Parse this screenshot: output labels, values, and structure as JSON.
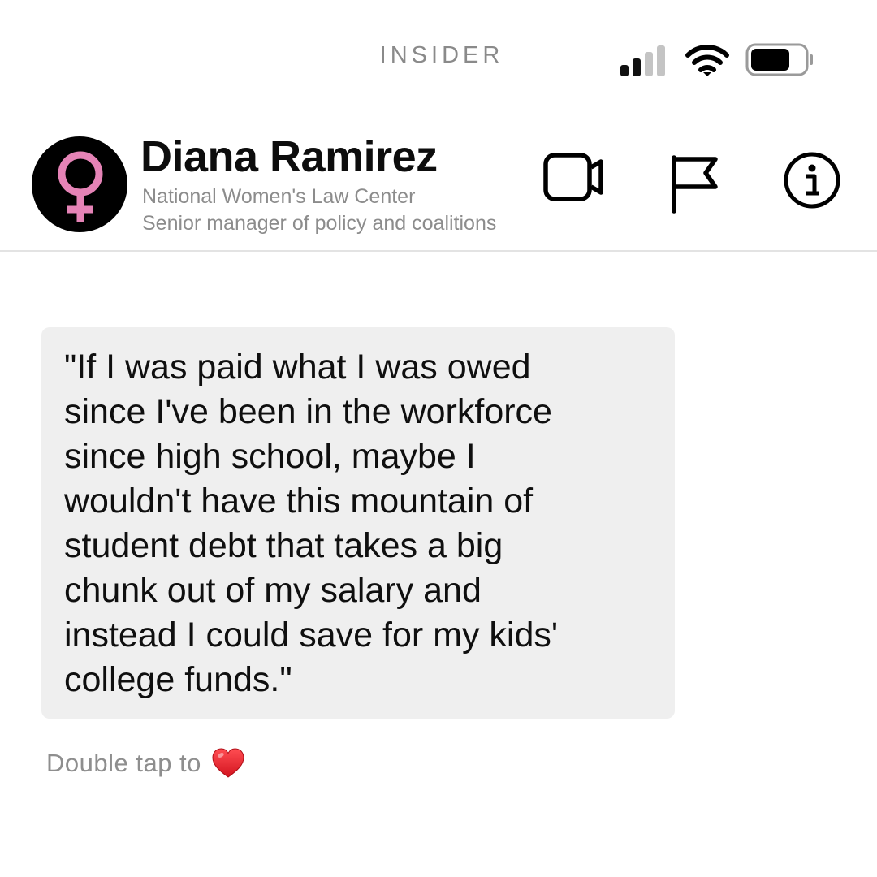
{
  "status_bar": {
    "brand": "INSIDER",
    "signal_icon": "cellular-signal-icon",
    "wifi_icon": "wifi-icon",
    "battery_icon": "battery-icon"
  },
  "header": {
    "avatar_icon": "female-symbol-icon",
    "name": "Diana Ramirez",
    "organization": "National Women's Law Center",
    "role": "Senior manager of policy and coalitions",
    "actions": [
      "video-camera-icon",
      "flag-icon",
      "info-icon"
    ]
  },
  "message": {
    "text": "\"If I was paid what I was owed\nsince I've been in the workforce\nsince high school, maybe I\nwouldn't have this mountain of\nstudent debt that takes a big\nchunk out of my salary and\ninstead I could save for my kids'\ncollege funds.\""
  },
  "reaction": {
    "label": "Double tap to",
    "icon": "heart-icon"
  },
  "colors": {
    "avatar_symbol": "#e583b6",
    "bubble_background": "#efefef",
    "heart": "#e8202a",
    "secondary_text": "#8c8c8c"
  }
}
